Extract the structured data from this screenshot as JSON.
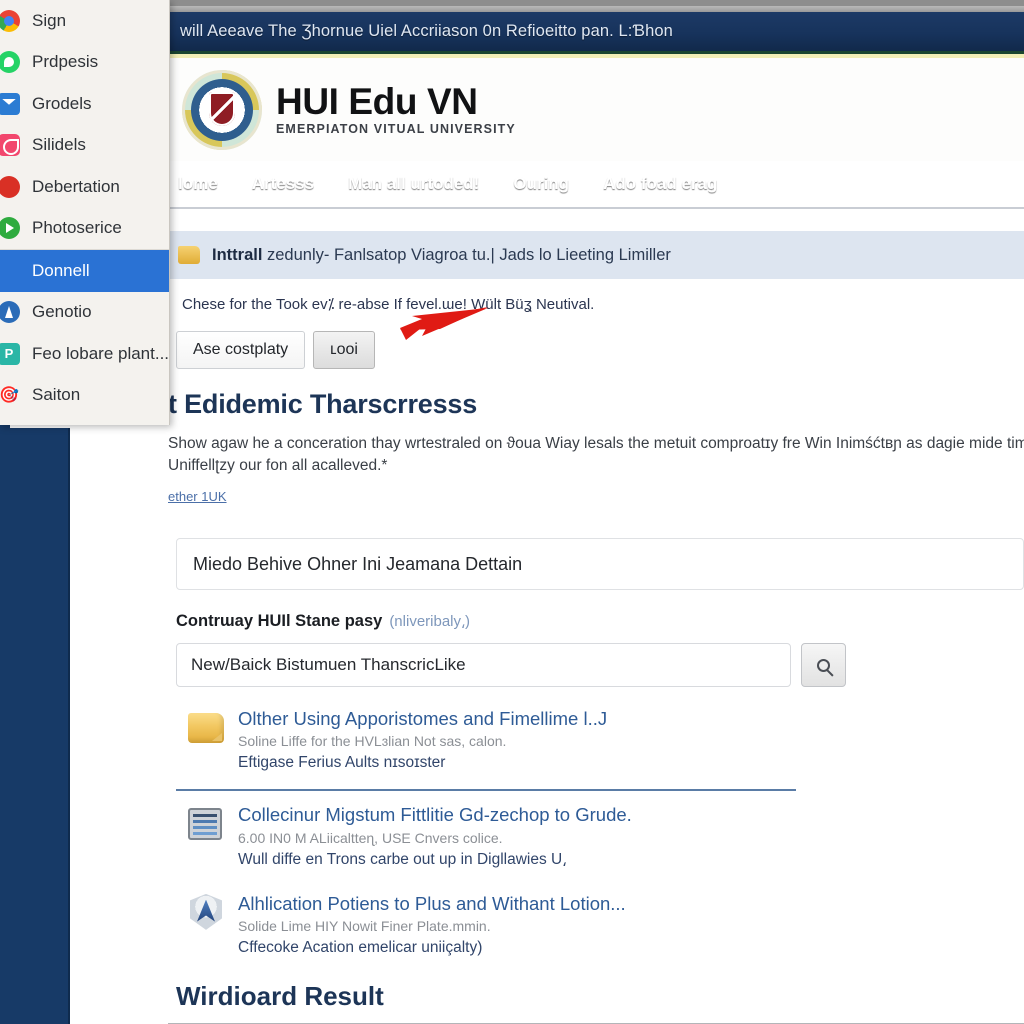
{
  "window": {
    "topbar_text": "will Aeeave The Ʒhornue Uiel Accriiason 0n Refioeitto pan. L:Ɓhon"
  },
  "brand": {
    "title": "HUI Edu VN",
    "subtitle": "EMERPIATON VITUAL UNIVERSITY",
    "crest_icon": "university-crest-icon"
  },
  "nav": {
    "items": [
      {
        "label": "lome"
      },
      {
        "label": "Artesss"
      },
      {
        "label": "Man all urtoded!"
      },
      {
        "label": "Ouring"
      },
      {
        "label": "Ado foad erag"
      }
    ]
  },
  "banner": {
    "icon": "folder-icon",
    "strong": "Inttrall",
    "rest": " zedunly- Fanlsatop Viagroa tu.| Jads lo Lieeting Limiller",
    "note": "Chese for the Took ev⁒ re-abse If fevel.ɯe! Wült Büʓ Neutival.",
    "buttons": [
      {
        "label": "Ase costplaty",
        "style": "primary"
      },
      {
        "label": "ʟooi",
        "style": "secondary"
      }
    ]
  },
  "main": {
    "heading": "t Edidemic Tharscrresss",
    "paragraph": "Show agaw he a conceration thay wrtestraled on ϑoua Wiay lesals the metuit comproatɪy fre Win Inimśćtʙɲ as dagie mide time Uniffellʈzy our fon all acalleved.*",
    "link": "ether 1UK",
    "wide_field_value": "Miedo Behive Ohner Ini Jeamana Dettain",
    "search_label": "Contrɯay HUIl Stane pasy",
    "search_label_muted": "(nliveribaly⸲)",
    "search_value": "New/Baick Bistumuen ThanscricLike",
    "search_icon": "search-icon"
  },
  "results": [
    {
      "icon": "folder-icon",
      "title": "Olther Using Apporistomes and Fimellime l..J",
      "subtitle": "Soline Liffe for the HVLɜlian Not sas, calon.",
      "meta": "Eftigase Ferius Aults nɪsoɪster",
      "divider_below": true
    },
    {
      "icon": "screen-document-icon",
      "title": "Collecinur Migstum Fittlitie Gd-zechop to Grude.",
      "subtitle": "6.00 IN0 M ALiicaltteɳ, USE Cnvers colice.",
      "meta": "Wull diffe en Trons carbe out up in Digllawies U⸲",
      "divider_below": false
    },
    {
      "icon": "shield-compass-icon",
      "title": "Alhlication Potiens to Plus and Withant Lotion...",
      "subtitle": "Solide Lime HIY Nowit Finer Plate.mmin.",
      "meta": "Cffecoke Acation emelicar uniiçalty)",
      "divider_below": false
    }
  ],
  "footer": {
    "heading": "Wirdioard Result"
  },
  "menu": {
    "items": [
      {
        "label": "Sign",
        "icon": "chrome-icon",
        "icon_class": "ic-chrome",
        "selected": false
      },
      {
        "label": "Prdpesis",
        "icon": "whatsapp-icon",
        "icon_class": "ic-whatsapp",
        "selected": false
      },
      {
        "label": "Grodels",
        "icon": "mail-icon",
        "icon_class": "ic-mail",
        "selected": false
      },
      {
        "label": "Silidels",
        "icon": "pin-icon",
        "icon_class": "ic-pink",
        "selected": false
      },
      {
        "label": "Debertation",
        "icon": "record-icon",
        "icon_class": "ic-red",
        "selected": false
      },
      {
        "label": "Photoserice",
        "icon": "play-icon",
        "icon_class": "ic-green",
        "selected": false
      },
      {
        "label": "Donnell",
        "icon": "none-icon",
        "icon_class": "",
        "selected": true
      },
      {
        "label": "Genotio",
        "icon": "navigate-icon",
        "icon_class": "ic-bluenav",
        "selected": false
      },
      {
        "label": "Feo lobare plant...",
        "icon": "pinterest-icon",
        "icon_class": "ic-teal",
        "selected": false
      },
      {
        "label": "Saiton",
        "icon": "target-icon",
        "icon_class": "ic-maroon",
        "selected": false
      }
    ]
  },
  "annotation": {
    "arrow_color": "#e01b14",
    "arrow_name": "red-pointer-arrow"
  },
  "colors": {
    "navy": "#173a67",
    "nav_blue": "#1b4374",
    "banner_blue": "#dde5f0",
    "link_blue": "#2e5b96",
    "heading_blue": "#1d3557"
  }
}
